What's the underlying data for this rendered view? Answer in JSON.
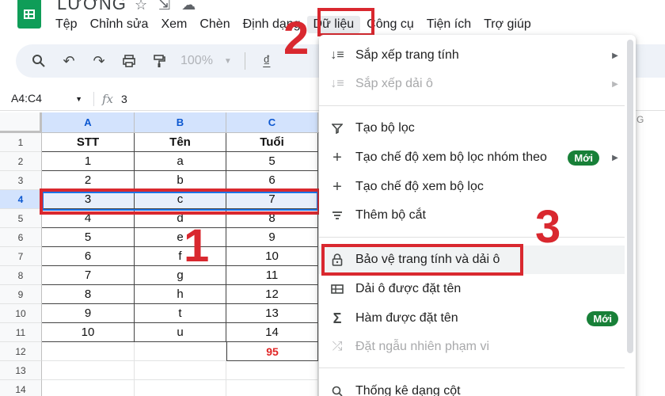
{
  "app": {
    "title": "LƯƠNG",
    "icons": [
      "star-icon",
      "move-to-folder-icon",
      "cloud-status-icon"
    ]
  },
  "menubar": [
    "Tệp",
    "Chỉnh sửa",
    "Xem",
    "Chèn",
    "Định dạng",
    "Dữ liệu",
    "Công cụ",
    "Tiện ích",
    "Trợ giúp"
  ],
  "toolbar": {
    "zoom": "100%",
    "currency": "₫",
    "icons": [
      "search-icon",
      "undo-icon",
      "redo-icon",
      "print-icon",
      "paint-format-icon",
      "zoom-dropdown",
      "currency-format-icon"
    ]
  },
  "formula_bar": {
    "name_box": "A4:C4",
    "fx": "fx",
    "value": "3"
  },
  "grid": {
    "columns": [
      "A",
      "B",
      "C"
    ],
    "extra_column": "G",
    "rows": [
      {
        "num": "1",
        "cells": [
          "STT",
          "Tên",
          "Tuổi"
        ]
      },
      {
        "num": "2",
        "cells": [
          "1",
          "a",
          "5"
        ]
      },
      {
        "num": "3",
        "cells": [
          "2",
          "b",
          "6"
        ]
      },
      {
        "num": "4",
        "cells": [
          "3",
          "c",
          "7"
        ]
      },
      {
        "num": "5",
        "cells": [
          "4",
          "d",
          "8"
        ]
      },
      {
        "num": "6",
        "cells": [
          "5",
          "e",
          "9"
        ]
      },
      {
        "num": "7",
        "cells": [
          "6",
          "f",
          "10"
        ]
      },
      {
        "num": "8",
        "cells": [
          "7",
          "g",
          "11"
        ]
      },
      {
        "num": "9",
        "cells": [
          "8",
          "h",
          "12"
        ]
      },
      {
        "num": "10",
        "cells": [
          "9",
          "t",
          "13"
        ]
      },
      {
        "num": "11",
        "cells": [
          "10",
          "u",
          "14"
        ]
      },
      {
        "num": "12",
        "cells": [
          "",
          "",
          "95"
        ]
      },
      {
        "num": "13",
        "cells": [
          "",
          "",
          ""
        ]
      },
      {
        "num": "14",
        "cells": [
          "",
          "",
          ""
        ]
      }
    ]
  },
  "data_menu": {
    "items": [
      {
        "label": "Sắp xếp trang tính",
        "icon": "sort-icon",
        "submenu": true,
        "disabled": false
      },
      {
        "label": "Sắp xếp dải ô",
        "icon": "sort-range-icon",
        "submenu": true,
        "disabled": true
      },
      {
        "label": "Tạo bộ lọc",
        "icon": "filter-icon",
        "submenu": false,
        "disabled": false
      },
      {
        "label": "Tạo chế độ xem bộ lọc nhóm theo",
        "icon": "plus-icon",
        "submenu": true,
        "disabled": false,
        "badge": "Mới"
      },
      {
        "label": "Tạo chế độ xem bộ lọc",
        "icon": "plus-icon",
        "submenu": false,
        "disabled": false
      },
      {
        "label": "Thêm bộ cắt",
        "icon": "slicer-icon",
        "submenu": false,
        "disabled": false
      },
      {
        "label": "Bảo vệ trang tính và dải ô",
        "icon": "lock-icon",
        "submenu": false,
        "disabled": false
      },
      {
        "label": "Dải ô được đặt tên",
        "icon": "named-range-icon",
        "submenu": false,
        "disabled": false
      },
      {
        "label": "Hàm được đặt tên",
        "icon": "sigma-icon",
        "submenu": false,
        "disabled": false,
        "badge": "Mới"
      },
      {
        "label": "Đặt ngẫu nhiên phạm vi",
        "icon": "shuffle-icon",
        "submenu": false,
        "disabled": true
      },
      {
        "label": "Thống kê dạng cột",
        "icon": "column-stats-icon",
        "submenu": false,
        "disabled": false
      }
    ]
  },
  "annotations": {
    "step1": "1",
    "step2": "2",
    "step3": "3",
    "highlight_color": "#d9282f"
  },
  "colors": {
    "sheets_green": "#0f9d58",
    "selection_blue": "#1a73e8",
    "badge_green": "#188038",
    "total_red": "#e02424"
  }
}
